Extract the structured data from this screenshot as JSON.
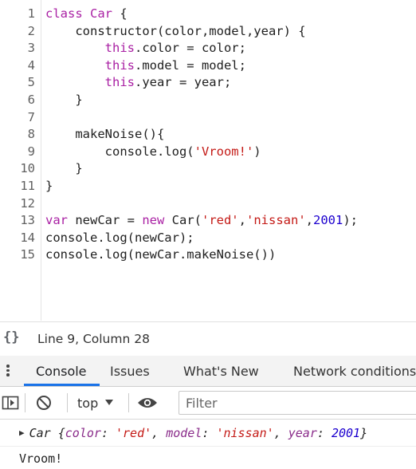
{
  "editor": {
    "lines": [
      {
        "n": "1",
        "tokens": [
          {
            "t": "class ",
            "c": "kw"
          },
          {
            "t": "Car",
            "c": "cls"
          },
          {
            "t": " {",
            "c": ""
          }
        ]
      },
      {
        "n": "2",
        "tokens": [
          {
            "t": "    constructor(color,model,year) {",
            "c": ""
          }
        ]
      },
      {
        "n": "3",
        "tokens": [
          {
            "t": "        ",
            "c": ""
          },
          {
            "t": "this",
            "c": "this"
          },
          {
            "t": ".color = color;",
            "c": ""
          }
        ]
      },
      {
        "n": "4",
        "tokens": [
          {
            "t": "        ",
            "c": ""
          },
          {
            "t": "this",
            "c": "this"
          },
          {
            "t": ".model = model;",
            "c": ""
          }
        ]
      },
      {
        "n": "5",
        "tokens": [
          {
            "t": "        ",
            "c": ""
          },
          {
            "t": "this",
            "c": "this"
          },
          {
            "t": ".year = year;",
            "c": ""
          }
        ]
      },
      {
        "n": "6",
        "tokens": [
          {
            "t": "    }",
            "c": ""
          }
        ]
      },
      {
        "n": "7",
        "tokens": []
      },
      {
        "n": "8",
        "tokens": [
          {
            "t": "    makeNoise(){",
            "c": ""
          }
        ]
      },
      {
        "n": "9",
        "tokens": [
          {
            "t": "        console.log(",
            "c": ""
          },
          {
            "t": "'Vroom!'",
            "c": "str"
          },
          {
            "t": ")",
            "c": ""
          }
        ]
      },
      {
        "n": "10",
        "tokens": [
          {
            "t": "    }",
            "c": ""
          }
        ]
      },
      {
        "n": "11",
        "tokens": [
          {
            "t": "}",
            "c": ""
          }
        ]
      },
      {
        "n": "12",
        "tokens": []
      },
      {
        "n": "13",
        "tokens": [
          {
            "t": "var ",
            "c": "kw"
          },
          {
            "t": "newCar = ",
            "c": ""
          },
          {
            "t": "new ",
            "c": "kw"
          },
          {
            "t": "Car(",
            "c": ""
          },
          {
            "t": "'red'",
            "c": "str"
          },
          {
            "t": ",",
            "c": ""
          },
          {
            "t": "'nissan'",
            "c": "str"
          },
          {
            "t": ",",
            "c": ""
          },
          {
            "t": "2001",
            "c": "num"
          },
          {
            "t": ");",
            "c": ""
          }
        ]
      },
      {
        "n": "14",
        "tokens": [
          {
            "t": "console.log(newCar);",
            "c": ""
          }
        ]
      },
      {
        "n": "15",
        "tokens": [
          {
            "t": "console.log(newCar.makeNoise())",
            "c": ""
          }
        ]
      }
    ]
  },
  "status": {
    "braces": "{}",
    "position": "Line 9, Column 28"
  },
  "tabs": {
    "console": "Console",
    "issues": "Issues",
    "whats_new": "What's New",
    "network_conditions": "Network conditions"
  },
  "toolbar": {
    "context": "top",
    "filter_placeholder": "Filter"
  },
  "console": {
    "object_class": "Car",
    "open": "{",
    "k_color": "color",
    "v_color": "'red'",
    "k_model": "model",
    "v_model": "'nissan'",
    "k_year": "year",
    "v_year": "2001",
    "close": "}",
    "log_output": "Vroom!"
  },
  "colors": {
    "keyword": "#a91fa3",
    "string": "#c41a16",
    "number": "#1c00cf",
    "active_tab": "#1a73e8"
  }
}
